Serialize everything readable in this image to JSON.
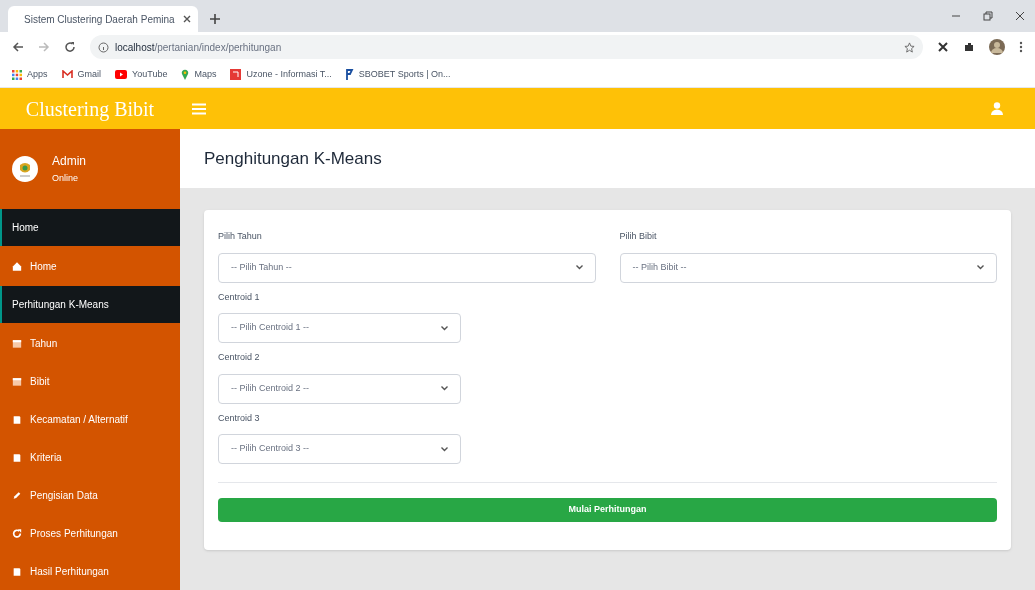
{
  "browser": {
    "tab_title": "Sistem Clustering Daerah Pemina",
    "url_host": "localhost",
    "url_path": "/pertanian/index/perhitungan",
    "bookmarks": [
      {
        "label": "Apps"
      },
      {
        "label": "Gmail"
      },
      {
        "label": "YouTube"
      },
      {
        "label": "Maps"
      },
      {
        "label": "Uzone - Informasi T..."
      },
      {
        "label": "SBOBET Sports | On..."
      }
    ]
  },
  "app": {
    "brand": "Clustering Bibit",
    "user": {
      "name": "Admin",
      "status": "Online"
    }
  },
  "sidebar": {
    "items": [
      {
        "kind": "header",
        "label": "Home"
      },
      {
        "kind": "link",
        "label": "Home"
      },
      {
        "kind": "header",
        "label": "Perhitungan K-Means"
      },
      {
        "kind": "link",
        "label": "Tahun"
      },
      {
        "kind": "link",
        "label": "Bibit"
      },
      {
        "kind": "link",
        "label": "Kecamatan / Alternatif"
      },
      {
        "kind": "link",
        "label": "Kriteria"
      },
      {
        "kind": "link",
        "label": "Pengisian Data"
      },
      {
        "kind": "link",
        "label": "Proses Perhitungan"
      },
      {
        "kind": "link",
        "label": "Hasil Perhitungan"
      }
    ]
  },
  "page": {
    "title": "Penghitungan K-Means"
  },
  "form": {
    "fields": [
      {
        "kind": "wide",
        "label": "Pilih Tahun",
        "value": "-- Pilih Tahun --"
      },
      {
        "kind": "wide",
        "label": "Pilih Bibit",
        "value": "-- Pilih Bibit --"
      },
      {
        "kind": "narrow",
        "label": "Centroid 1",
        "value": "-- Pilih Centroid 1 --"
      },
      {
        "kind": "narrow",
        "label": "Centroid 2",
        "value": "-- Pilih Centroid 2 --"
      },
      {
        "kind": "narrow",
        "label": "Centroid 3",
        "value": "-- Pilih Centroid 3 --"
      }
    ],
    "submit": "Mulai Perhitungan"
  }
}
